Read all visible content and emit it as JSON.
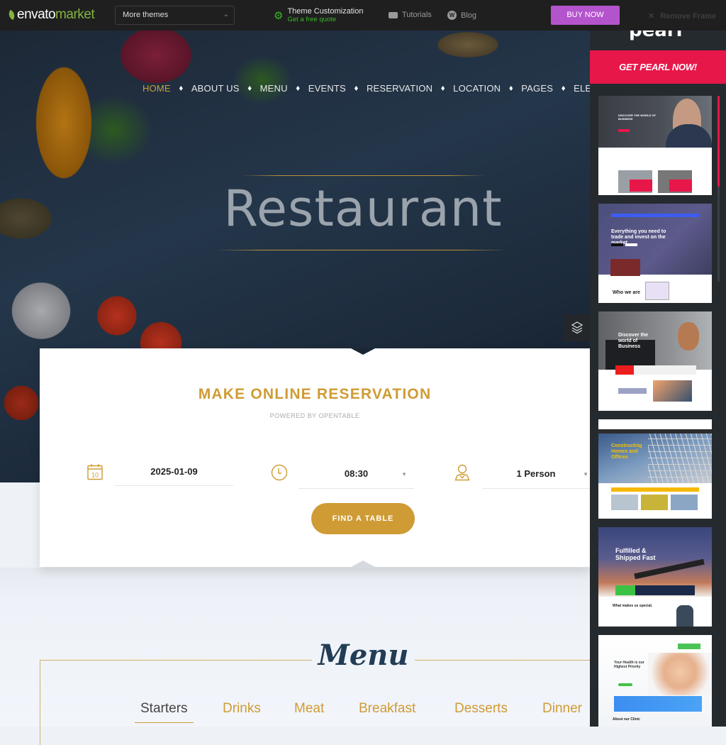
{
  "topbar": {
    "logo_main": "envato",
    "logo_accent": "market",
    "themes_select": "More themes",
    "customization_title": "Theme Customization",
    "customization_sub": "Get a free quote",
    "tutorials": "Tutorials",
    "blog": "Blog",
    "buy_now": "BUY NOW",
    "remove_frame": "Remove Frame"
  },
  "nav": {
    "items": [
      "HOME",
      "ABOUT US",
      "MENU",
      "EVENTS",
      "RESERVATION",
      "LOCATION",
      "PAGES",
      "ELEMENTS"
    ],
    "active": "HOME"
  },
  "hero": {
    "title": "Restaurant"
  },
  "reservation": {
    "title": "MAKE ONLINE RESERVATION",
    "subtitle": "POWERED BY OPENTABLE",
    "date": "2025-01-09",
    "calendar_day": "10",
    "time": "08:30",
    "party": "1 Person",
    "button": "FIND A TABLE"
  },
  "menu_section": {
    "title": "Menu",
    "tabs": [
      "Starters",
      "Drinks",
      "Meat",
      "Breakfast",
      "Desserts",
      "Dinner"
    ],
    "active_tab": "Starters"
  },
  "sidebar": {
    "brand": "pearl",
    "cta": "GET PEARL NOW!",
    "thumbnails": [
      {
        "headline": "DISCOVER THE WORLD OF BUSINESS",
        "theme": "business"
      },
      {
        "headline": "Everything you need to trade and invest on the market",
        "theme": "finance"
      },
      {
        "headline": "Discover the world of Business",
        "theme": "corporate"
      },
      {
        "headline": "Constructing Homes and Offices",
        "theme": "construction"
      },
      {
        "headline": "Fulfilled & Shipped Fast",
        "theme": "transportation"
      },
      {
        "headline": "Your Health is our Highest Priority",
        "theme": "medical"
      }
    ]
  },
  "colors": {
    "accent_gold": "#cf9b34",
    "buy_purple": "#b454cd",
    "pearl_red": "#e8174a",
    "envato_green": "#82b440"
  }
}
